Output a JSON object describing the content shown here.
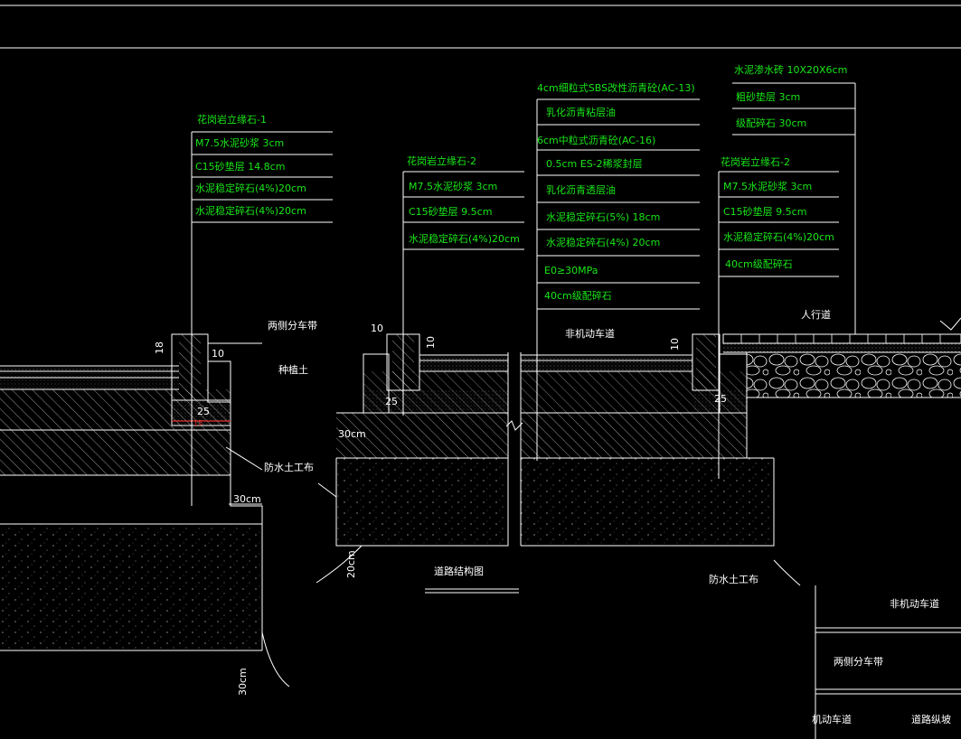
{
  "callouts": {
    "kerb1": {
      "title": "花岗岩立缘石-1",
      "rows": [
        "M7.5水泥砂浆    3cm",
        "C15砂垫层       14.8cm",
        "水泥稳定碎石(4%)20cm",
        "水泥稳定碎石(4%)20cm"
      ]
    },
    "kerb2_left": {
      "title": "花岗岩立缘石-2",
      "rows": [
        "M7.5水泥砂浆 3cm",
        "C15砂垫层     9.5cm",
        "水泥稳定碎石(4%)20cm"
      ]
    },
    "pavement": {
      "title": "4cm细粒式SBS改性沥青砼(AC-13)",
      "rows": [
        "乳化沥青粘层油",
        "6cm中粒式沥青砼(AC-16)",
        "0.5cm ES-2稀浆封层",
        "乳化沥青透层油",
        "水泥稳定碎石(5%)     18cm",
        "水泥稳定碎石(4%)     20cm",
        "E0≥30MPa",
        "40cm级配碎石"
      ]
    },
    "sidewalk": {
      "title": "水泥渗水砖 10X20X6cm",
      "rows": [
        "粗砂垫层        3cm",
        "级配碎石        30cm"
      ]
    },
    "kerb2_right": {
      "title": "花岗岩立缘石-2",
      "rows": [
        "M7.5水泥砂浆     3cm",
        "C15砂垫层      9.5cm",
        "水泥稳定碎石(4%)20cm",
        "40cm级配碎石"
      ]
    }
  },
  "labels": {
    "median_strip": "两侧分车带",
    "planting_soil": "种植土",
    "non_motor_lane": "非机动车道",
    "sidewalk": "人行道",
    "geotextile_left": "防水土工布",
    "geotextile_right": "防水土工布",
    "drawing_title": "道路结构图",
    "legend_non_motor": "非机动车道",
    "legend_median": "两侧分车带",
    "legend_motor": "机动车道",
    "legend_centerline": "道路纵坡"
  },
  "dims": {
    "d18": "18",
    "d10a": "10",
    "d25a": "25",
    "d30a": "30cm",
    "d10b": "10",
    "d10c": "10",
    "d25b": "25",
    "d30b": "30cm",
    "d20": "20cm",
    "d10d": "10",
    "d25c": "25",
    "d30c": "30cm",
    "d15": "15"
  },
  "colors": {
    "annotation_text": "#19e619",
    "linework": "#ffffff",
    "background": "#000000",
    "dimension_red": "#e03030"
  }
}
